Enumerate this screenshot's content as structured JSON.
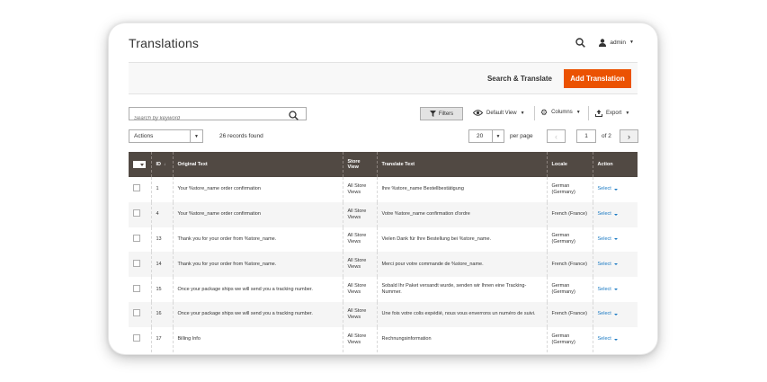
{
  "page": {
    "title": "Translations"
  },
  "header": {
    "user": "admin",
    "search_icon": "search-icon",
    "user_icon": "user-icon"
  },
  "actions": {
    "search_translate": "Search & Translate",
    "add_translation": "Add Translation"
  },
  "toolbar": {
    "search_placeholder": "Search by keyword",
    "filters": "Filters",
    "default_view": "Default View",
    "columns": "Columns",
    "export": "Export"
  },
  "mass": {
    "actions_label": "Actions",
    "records": "26 records found"
  },
  "pagination": {
    "per_page_value": "20",
    "per_page_label": "per page",
    "current_page": "1",
    "of": "of 2"
  },
  "grid": {
    "columns": [
      "ID",
      "Original Text",
      "Store View",
      "Translate Text",
      "Locale",
      "Action"
    ],
    "rows": [
      {
        "id": "1",
        "original": "Your %store_name order confirmation",
        "store": "All Store Views",
        "translate": "Ihre %store_name Bestellbestätigung",
        "locale": "German (Germany)",
        "action": "Select"
      },
      {
        "id": "4",
        "original": "Your %store_name order confirmation",
        "store": "All Store Views",
        "translate": "Votre %store_name confirmation d'ordre",
        "locale": "French (France)",
        "action": "Select"
      },
      {
        "id": "13",
        "original": "Thank you for your order from %store_name.",
        "store": "All Store Views",
        "translate": "Vielen Dank für Ihre Bestellung bei %store_name.",
        "locale": "German (Germany)",
        "action": "Select"
      },
      {
        "id": "14",
        "original": "Thank you for your order from %store_name.",
        "store": "All Store Views",
        "translate": "Merci pour votre commande de %store_name.",
        "locale": "French (France)",
        "action": "Select"
      },
      {
        "id": "15",
        "original": "Once your package ships we will send you a tracking number.",
        "store": "All Store Views",
        "translate": "Sobald Ihr Paket versandt wurde, senden wir Ihnen eine Tracking-Nummer.",
        "locale": "German (Germany)",
        "action": "Select"
      },
      {
        "id": "16",
        "original": "Once your package ships we will send you a tracking number.",
        "store": "All Store Views",
        "translate": "Une fois votre colis expédié, nous vous enverrons un numéro de suivi.",
        "locale": "French (France)",
        "action": "Select"
      },
      {
        "id": "17",
        "original": "Billing Info",
        "store": "All Store Views",
        "translate": "Rechnungsinformation",
        "locale": "German (Germany)",
        "action": "Select"
      }
    ]
  },
  "colors": {
    "accent": "#eb5202",
    "header_bg": "#514943",
    "link": "#1979c3"
  }
}
